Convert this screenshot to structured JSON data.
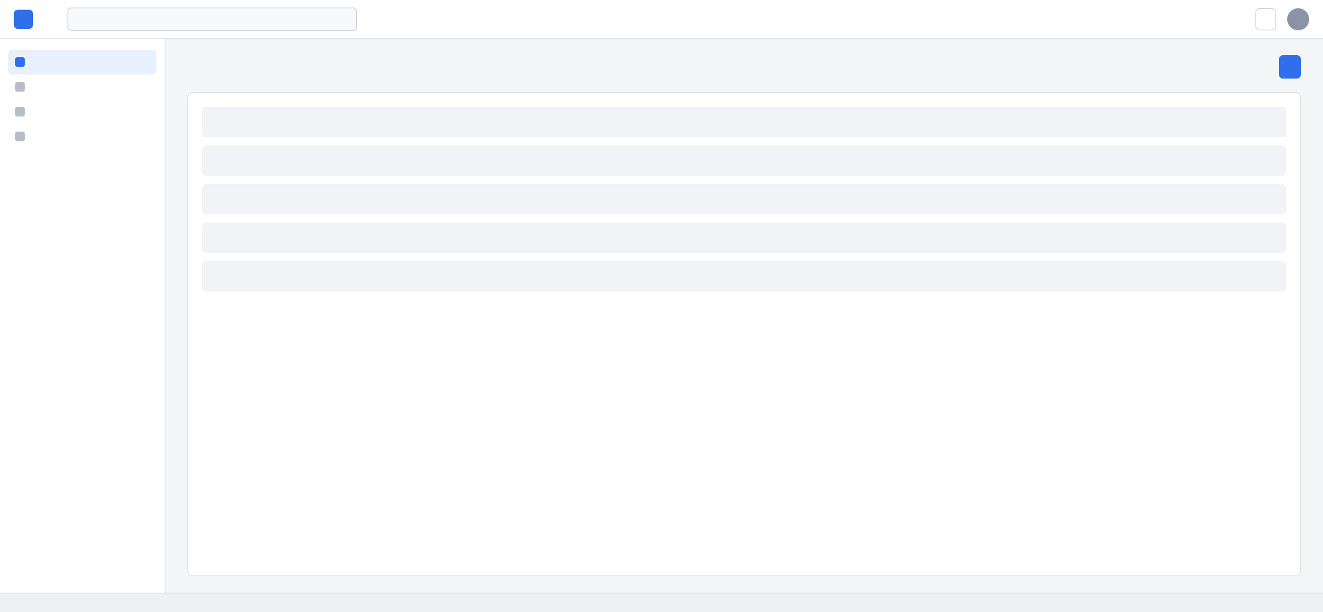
{
  "search": {
    "placeholder": ""
  }
}
